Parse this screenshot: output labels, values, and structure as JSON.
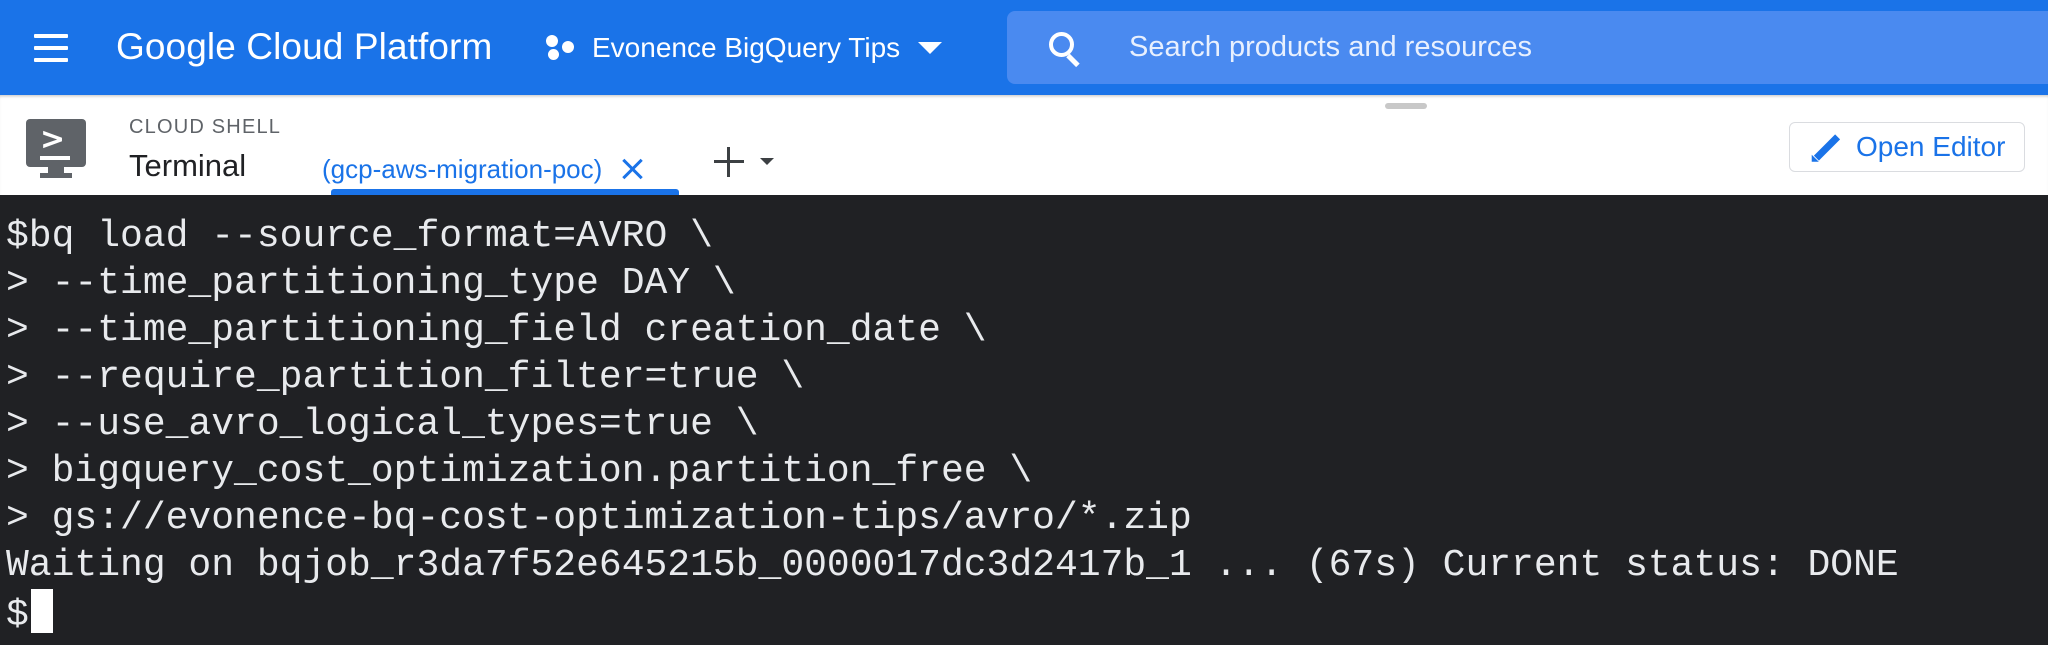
{
  "header": {
    "brand": "Google Cloud Platform",
    "project_name": "Evonence BigQuery Tips",
    "search": {
      "placeholder": "Search products and resources",
      "value": ""
    }
  },
  "shell": {
    "section_label": "CLOUD SHELL",
    "title": "Terminal",
    "tabs": [
      {
        "label": "(gcp-aws-migration-poc)"
      }
    ],
    "open_editor_label": "Open Editor"
  },
  "terminal": {
    "lines": [
      "$bq load --source_format=AVRO \\",
      "> --time_partitioning_type DAY \\",
      "> --time_partitioning_field creation_date \\",
      "> --require_partition_filter=true \\",
      "> --use_avro_logical_types=true \\",
      "> bigquery_cost_optimization.partition_free \\",
      "> gs://evonence-bq-cost-optimization-tips/avro/*.zip",
      "Waiting on bqjob_r3da7f52e645215b_0000017dc3d2417b_1 ... (67s) Current status: DONE"
    ],
    "prompt": "$"
  },
  "colors": {
    "header_blue": "#1a73e8",
    "terminal_bg": "#202124",
    "terminal_text": "#e8eaed"
  }
}
